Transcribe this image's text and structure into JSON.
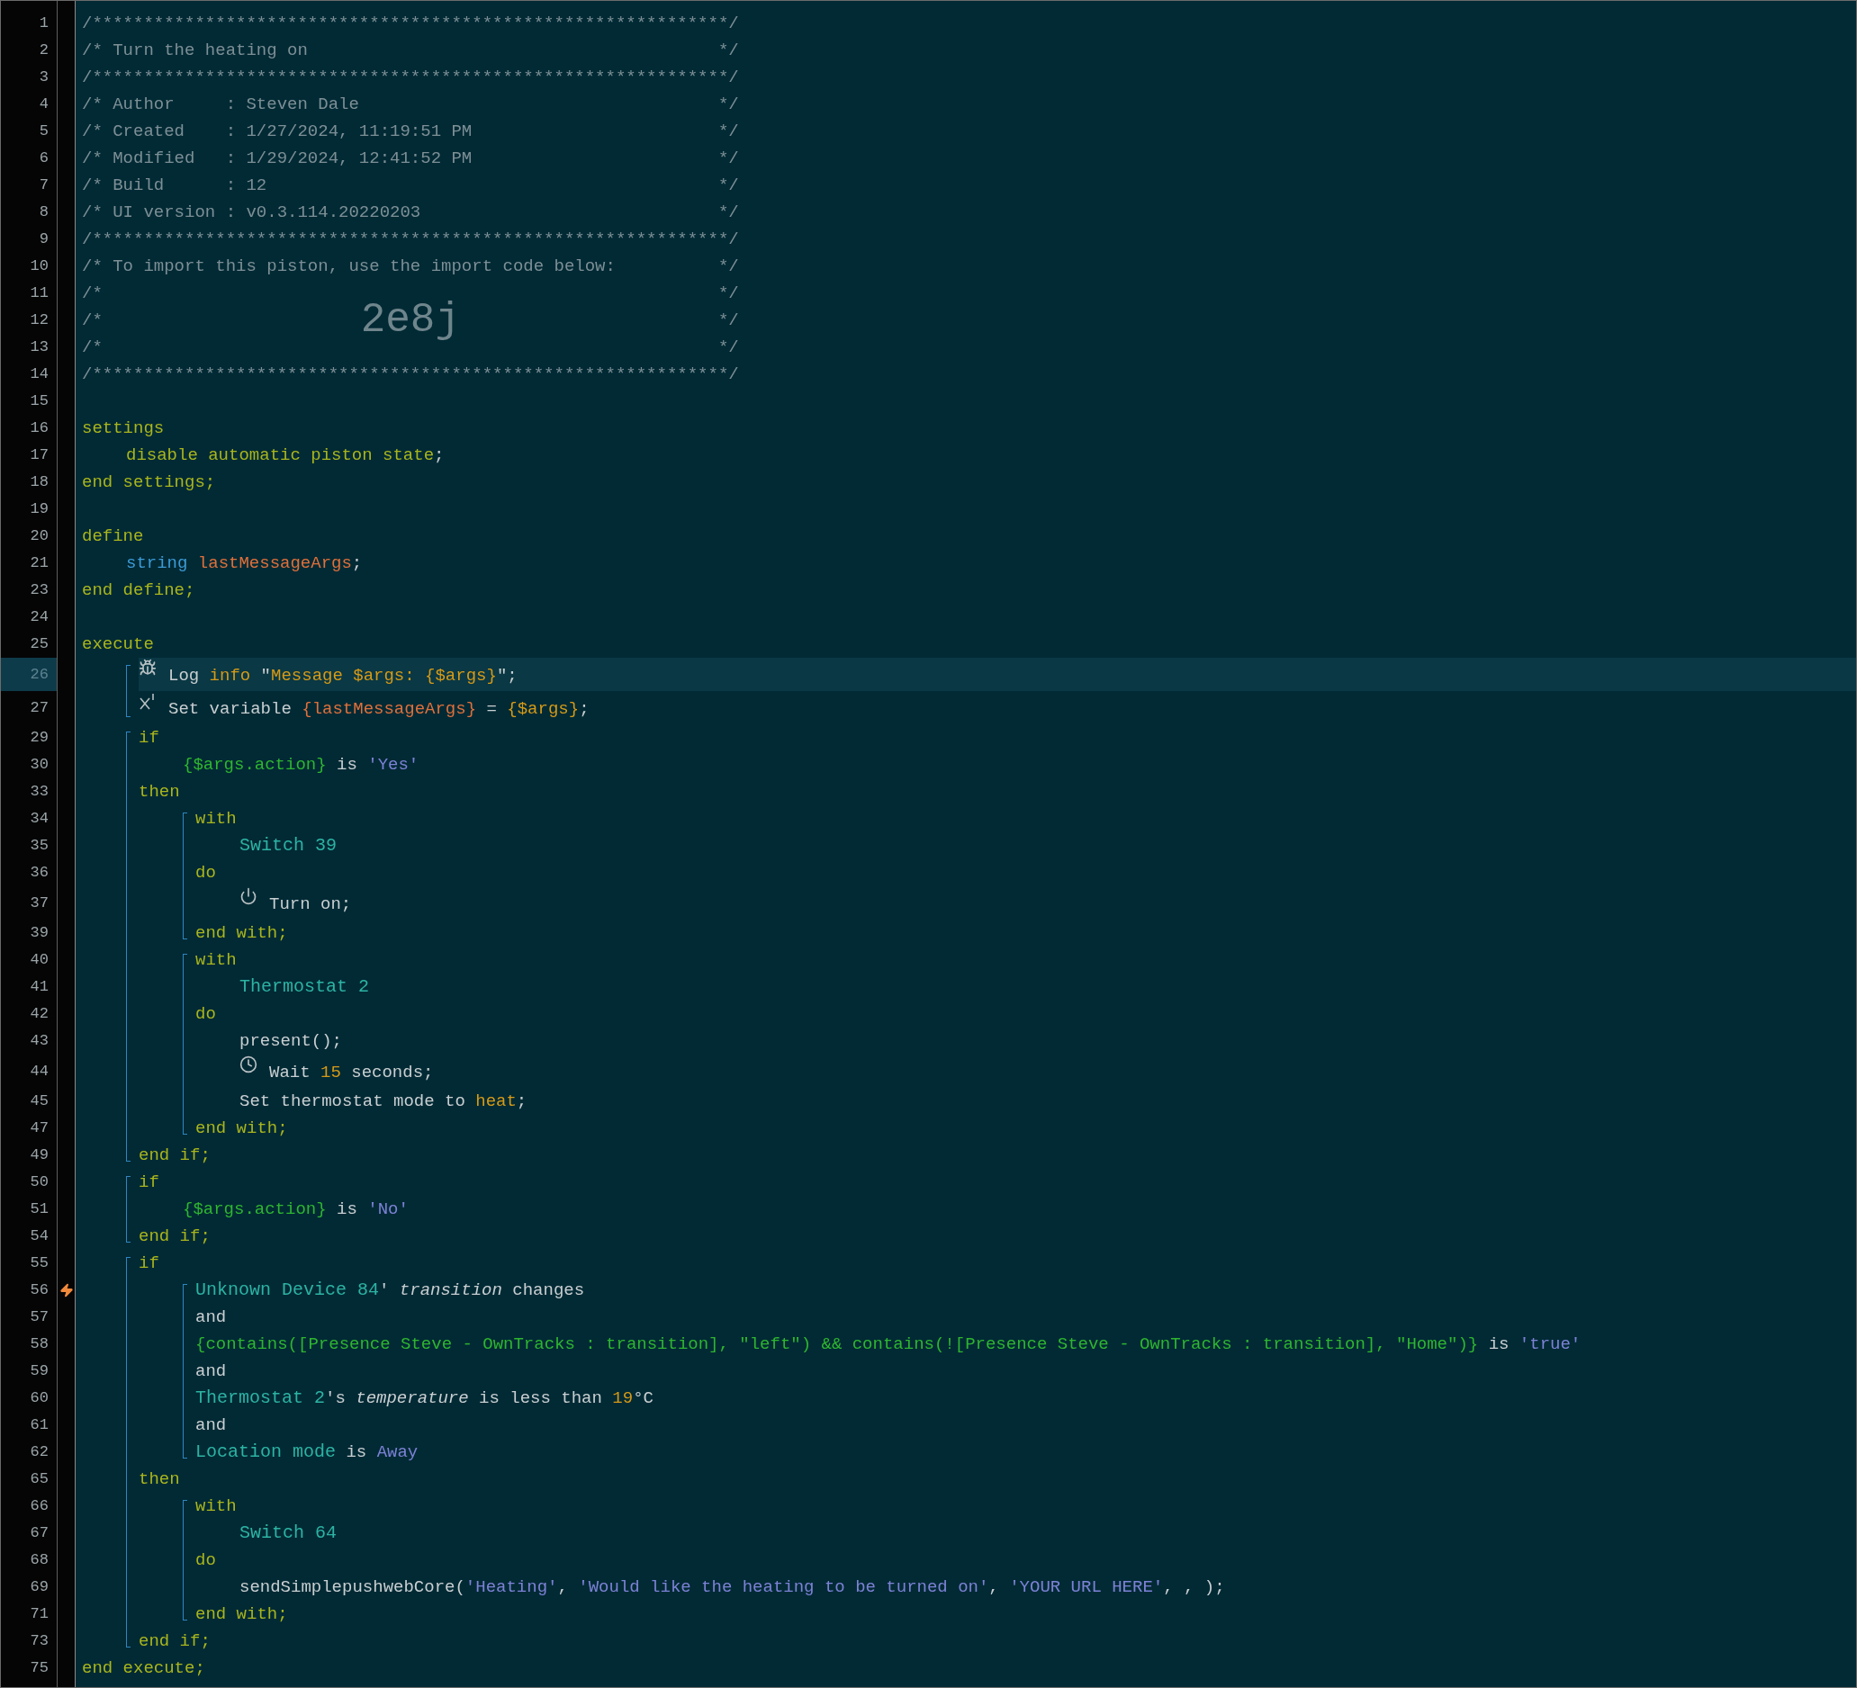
{
  "lines": [
    {
      "kind": "box",
      "number": "1",
      "selected": false,
      "trigger": false,
      "tokens": [
        {
          "kind": "comment",
          "text": "/**************************************************************/"
        }
      ]
    },
    {
      "kind": "box",
      "number": "2",
      "selected": false,
      "trigger": false,
      "tokens": [
        {
          "kind": "comment",
          "text": "/* Turn the heating on"
        },
        {
          "kind": "comment",
          "text": "*/"
        }
      ]
    },
    {
      "kind": "box",
      "number": "3",
      "selected": false,
      "trigger": false,
      "tokens": [
        {
          "kind": "comment",
          "text": "/**************************************************************/"
        }
      ]
    },
    {
      "kind": "box",
      "number": "4",
      "selected": false,
      "trigger": false,
      "tokens": [
        {
          "kind": "comment",
          "text": "/* Author     : Steven Dale"
        },
        {
          "kind": "comment",
          "text": "*/"
        }
      ]
    },
    {
      "kind": "box",
      "number": "5",
      "selected": false,
      "trigger": false,
      "tokens": [
        {
          "kind": "comment",
          "text": "/* Created    : 1/27/2024, 11:19:51 PM"
        },
        {
          "kind": "comment",
          "text": "*/"
        }
      ]
    },
    {
      "kind": "box",
      "number": "6",
      "selected": false,
      "trigger": false,
      "tokens": [
        {
          "kind": "comment",
          "text": "/* Modified   : 1/29/2024, 12:41:52 PM"
        },
        {
          "kind": "comment",
          "text": "*/"
        }
      ]
    },
    {
      "kind": "box",
      "number": "7",
      "selected": false,
      "trigger": false,
      "tokens": [
        {
          "kind": "comment",
          "text": "/* Build      : 12"
        },
        {
          "kind": "comment",
          "text": "*/"
        }
      ]
    },
    {
      "kind": "box",
      "number": "8",
      "selected": false,
      "trigger": false,
      "tokens": [
        {
          "kind": "comment",
          "text": "/* UI version : v0.3.114.20220203"
        },
        {
          "kind": "comment",
          "text": "*/"
        }
      ]
    },
    {
      "kind": "box",
      "number": "9",
      "selected": false,
      "trigger": false,
      "tokens": [
        {
          "kind": "comment",
          "text": "/**************************************************************/"
        }
      ]
    },
    {
      "kind": "box",
      "number": "10",
      "selected": false,
      "trigger": false,
      "tokens": [
        {
          "kind": "comment",
          "text": "/* To import this piston, use the import code below:"
        },
        {
          "kind": "comment",
          "text": "*/"
        }
      ]
    },
    {
      "kind": "box",
      "number": "11",
      "selected": false,
      "trigger": false,
      "tokens": [
        {
          "kind": "comment",
          "text": "/*"
        },
        {
          "kind": "comment",
          "text": "*/"
        }
      ]
    },
    {
      "kind": "box",
      "number": "12",
      "selected": false,
      "trigger": false,
      "tokens": [
        {
          "kind": "comment",
          "text": "/*"
        },
        {
          "kind": "import_code",
          "text": "2e8j"
        },
        {
          "kind": "comment",
          "text": "*/"
        }
      ]
    },
    {
      "kind": "box",
      "number": "13",
      "selected": false,
      "trigger": false,
      "tokens": [
        {
          "kind": "comment",
          "text": "/*"
        },
        {
          "kind": "comment",
          "text": "*/"
        }
      ]
    },
    {
      "kind": "box",
      "number": "14",
      "selected": false,
      "trigger": false,
      "tokens": [
        {
          "kind": "comment",
          "text": "/**************************************************************/"
        }
      ]
    },
    {
      "kind": "blank",
      "number": "15",
      "selected": false,
      "trigger": false
    },
    {
      "kind": "code",
      "number": "16",
      "selected": false,
      "trigger": false,
      "tokens": [
        {
          "kind": "keyword",
          "text": "settings"
        }
      ],
      "children": [
        {
          "kind": "code",
          "number": "17",
          "selected": false,
          "trigger": false,
          "tokens": [
            {
              "kind": "keyword",
              "text": "disable automatic piston state"
            },
            {
              "kind": "plain",
              "text": ";"
            }
          ]
        }
      ]
    },
    {
      "kind": "code",
      "number": "18",
      "selected": false,
      "trigger": false,
      "tokens": [
        {
          "kind": "keyword",
          "text": "end settings;"
        }
      ]
    },
    {
      "kind": "blank",
      "number": "19",
      "selected": false,
      "trigger": false
    },
    {
      "kind": "code",
      "number": "20",
      "selected": false,
      "trigger": false,
      "tokens": [
        {
          "kind": "keyword",
          "text": "define"
        }
      ],
      "children": [
        {
          "kind": "code",
          "number": "21",
          "selected": false,
          "trigger": false,
          "tokens": [
            {
              "kind": "type",
              "text": "string "
            },
            {
              "kind": "variable",
              "text": "lastMessageArgs"
            },
            {
              "kind": "plain",
              "text": ";"
            }
          ]
        }
      ]
    },
    {
      "kind": "code",
      "number": "23",
      "selected": false,
      "trigger": false,
      "tokens": [
        {
          "kind": "keyword",
          "text": "end define;"
        }
      ]
    },
    {
      "kind": "blank",
      "number": "24",
      "selected": false,
      "trigger": false
    },
    {
      "kind": "code",
      "number": "25",
      "selected": false,
      "trigger": false,
      "tokens": [
        {
          "kind": "keyword",
          "text": "execute"
        }
      ],
      "children": [
        {
          "kind": "block",
          "items": [
            {
              "kind": "log",
              "number": "26",
              "selected": true,
              "trigger": false,
              "tokens": [
                {
                  "kind": "plain",
                  "text": "Log "
                },
                {
                  "kind": "system",
                  "text": "info"
                },
                {
                  "kind": "plain",
                  "text": " \""
                },
                {
                  "kind": "system",
                  "text": "Message $args: {$args}"
                },
                {
                  "kind": "plain",
                  "text": "\";"
                }
              ]
            },
            {
              "kind": "assign",
              "number": "27",
              "selected": false,
              "trigger": false,
              "tokens": [
                {
                  "kind": "plain",
                  "text": "Set variable "
                },
                {
                  "kind": "variable",
                  "text": "{lastMessageArgs}"
                },
                {
                  "kind": "plain",
                  "text": " = "
                },
                {
                  "kind": "system",
                  "text": "{$args}"
                },
                {
                  "kind": "plain",
                  "text": ";"
                }
              ]
            }
          ]
        },
        {
          "kind": "block",
          "items": [
            {
              "kind": "code",
              "number": "29",
              "selected": false,
              "trigger": false,
              "tokens": [
                {
                  "kind": "keyword",
                  "text": "if"
                }
              ],
              "children": [
                {
                  "kind": "code",
                  "number": "30",
                  "selected": false,
                  "trigger": false,
                  "tokens": [
                    {
                      "kind": "expression",
                      "text": "{$args.action}"
                    },
                    {
                      "kind": "plain",
                      "text": " is "
                    },
                    {
                      "kind": "string",
                      "text": "'Yes'"
                    }
                  ]
                }
              ]
            },
            {
              "kind": "code",
              "number": "33",
              "selected": false,
              "trigger": false,
              "tokens": [
                {
                  "kind": "keyword",
                  "text": "then"
                }
              ],
              "children": [
                {
                  "kind": "block",
                  "items": [
                    {
                      "kind": "code",
                      "number": "34",
                      "selected": false,
                      "trigger": false,
                      "tokens": [
                        {
                          "kind": "keyword",
                          "text": "with"
                        }
                      ],
                      "children": [
                        {
                          "kind": "code",
                          "number": "35",
                          "selected": false,
                          "trigger": false,
                          "tokens": [
                            {
                              "kind": "device",
                              "text": "Switch 39"
                            }
                          ]
                        }
                      ]
                    },
                    {
                      "kind": "code",
                      "number": "36",
                      "selected": false,
                      "trigger": false,
                      "tokens": [
                        {
                          "kind": "keyword",
                          "text": "do"
                        }
                      ],
                      "children": [
                        {
                          "kind": "command",
                          "number": "37",
                          "selected": false,
                          "trigger": false,
                          "tokens": [
                            {
                              "kind": "plain",
                              "text": "Turn on;"
                            }
                          ]
                        }
                      ]
                    },
                    {
                      "kind": "code",
                      "number": "39",
                      "selected": false,
                      "trigger": false,
                      "tokens": [
                        {
                          "kind": "keyword",
                          "text": "end with;"
                        }
                      ]
                    }
                  ]
                },
                {
                  "kind": "block",
                  "items": [
                    {
                      "kind": "code",
                      "number": "40",
                      "selected": false,
                      "trigger": false,
                      "tokens": [
                        {
                          "kind": "keyword",
                          "text": "with"
                        }
                      ],
                      "children": [
                        {
                          "kind": "code",
                          "number": "41",
                          "selected": false,
                          "trigger": false,
                          "tokens": [
                            {
                              "kind": "device",
                              "text": "Thermostat 2"
                            }
                          ]
                        }
                      ]
                    },
                    {
                      "kind": "code",
                      "number": "42",
                      "selected": false,
                      "trigger": false,
                      "tokens": [
                        {
                          "kind": "keyword",
                          "text": "do"
                        }
                      ],
                      "children": [
                        {
                          "kind": "code",
                          "number": "43",
                          "selected": false,
                          "trigger": false,
                          "tokens": [
                            {
                              "kind": "plain",
                              "text": "present();"
                            }
                          ]
                        },
                        {
                          "kind": "wait",
                          "number": "44",
                          "selected": false,
                          "trigger": false,
                          "tokens": [
                            {
                              "kind": "plain",
                              "text": "Wait "
                            },
                            {
                              "kind": "number",
                              "text": "15"
                            },
                            {
                              "kind": "plain",
                              "text": " seconds;"
                            }
                          ]
                        },
                        {
                          "kind": "code",
                          "number": "45",
                          "selected": false,
                          "trigger": false,
                          "tokens": [
                            {
                              "kind": "plain",
                              "text": "Set thermostat mode to "
                            },
                            {
                              "kind": "system",
                              "text": "heat"
                            },
                            {
                              "kind": "plain",
                              "text": ";"
                            }
                          ]
                        }
                      ]
                    },
                    {
                      "kind": "code",
                      "number": "47",
                      "selected": false,
                      "trigger": false,
                      "tokens": [
                        {
                          "kind": "keyword",
                          "text": "end with;"
                        }
                      ]
                    }
                  ]
                }
              ]
            },
            {
              "kind": "code",
              "number": "49",
              "selected": false,
              "trigger": false,
              "tokens": [
                {
                  "kind": "keyword",
                  "text": "end if;"
                }
              ]
            }
          ]
        },
        {
          "kind": "block",
          "items": [
            {
              "kind": "code",
              "number": "50",
              "selected": false,
              "trigger": false,
              "tokens": [
                {
                  "kind": "keyword",
                  "text": "if"
                }
              ],
              "children": [
                {
                  "kind": "code",
                  "number": "51",
                  "selected": false,
                  "trigger": false,
                  "tokens": [
                    {
                      "kind": "expression",
                      "text": "{$args.action}"
                    },
                    {
                      "kind": "plain",
                      "text": " is "
                    },
                    {
                      "kind": "string",
                      "text": "'No'"
                    }
                  ]
                }
              ]
            },
            {
              "kind": "code",
              "number": "54",
              "selected": false,
              "trigger": false,
              "tokens": [
                {
                  "kind": "keyword",
                  "text": "end if;"
                }
              ]
            }
          ]
        },
        {
          "kind": "block",
          "items": [
            {
              "kind": "code",
              "number": "55",
              "selected": false,
              "trigger": false,
              "tokens": [
                {
                  "kind": "keyword",
                  "text": "if"
                }
              ],
              "children": [
                {
                  "kind": "block",
                  "items": [
                    {
                      "kind": "code",
                      "number": "56",
                      "selected": false,
                      "trigger": true,
                      "tokens": [
                        {
                          "kind": "device",
                          "text": "Unknown Device 84"
                        },
                        {
                          "kind": "plain",
                          "text": "' "
                        },
                        {
                          "kind": "attribute",
                          "text": "transition"
                        },
                        {
                          "kind": "plain",
                          "text": " changes"
                        }
                      ]
                    },
                    {
                      "kind": "code",
                      "number": "57",
                      "selected": false,
                      "trigger": false,
                      "tokens": [
                        {
                          "kind": "plain",
                          "text": "and"
                        }
                      ]
                    },
                    {
                      "kind": "code",
                      "number": "58",
                      "selected": false,
                      "trigger": false,
                      "tokens": [
                        {
                          "kind": "expression",
                          "text": "{contains([Presence Steve - OwnTracks : transition], \"left\") && contains(![Presence Steve - OwnTracks : transition], \"Home\")}"
                        },
                        {
                          "kind": "plain",
                          "text": " is "
                        },
                        {
                          "kind": "string",
                          "text": "'true'"
                        }
                      ]
                    },
                    {
                      "kind": "code",
                      "number": "59",
                      "selected": false,
                      "trigger": false,
                      "tokens": [
                        {
                          "kind": "plain",
                          "text": "and"
                        }
                      ]
                    },
                    {
                      "kind": "code",
                      "number": "60",
                      "selected": false,
                      "trigger": false,
                      "tokens": [
                        {
                          "kind": "device",
                          "text": "Thermostat 2"
                        },
                        {
                          "kind": "plain",
                          "text": "'s "
                        },
                        {
                          "kind": "attribute",
                          "text": "temperature"
                        },
                        {
                          "kind": "plain",
                          "text": " is less than "
                        },
                        {
                          "kind": "number",
                          "text": "19"
                        },
                        {
                          "kind": "plain",
                          "text": "°C"
                        }
                      ]
                    },
                    {
                      "kind": "code",
                      "number": "61",
                      "selected": false,
                      "trigger": false,
                      "tokens": [
                        {
                          "kind": "plain",
                          "text": "and"
                        }
                      ]
                    },
                    {
                      "kind": "code",
                      "number": "62",
                      "selected": false,
                      "trigger": false,
                      "tokens": [
                        {
                          "kind": "device",
                          "text": "Location mode"
                        },
                        {
                          "kind": "plain",
                          "text": " is "
                        },
                        {
                          "kind": "string",
                          "text": "Away"
                        }
                      ]
                    }
                  ]
                }
              ]
            },
            {
              "kind": "code",
              "number": "65",
              "selected": false,
              "trigger": false,
              "tokens": [
                {
                  "kind": "keyword",
                  "text": "then"
                }
              ],
              "children": [
                {
                  "kind": "block",
                  "items": [
                    {
                      "kind": "code",
                      "number": "66",
                      "selected": false,
                      "trigger": false,
                      "tokens": [
                        {
                          "kind": "keyword",
                          "text": "with"
                        }
                      ],
                      "children": [
                        {
                          "kind": "code",
                          "number": "67",
                          "selected": false,
                          "trigger": false,
                          "tokens": [
                            {
                              "kind": "device",
                              "text": "Switch 64"
                            }
                          ]
                        }
                      ]
                    },
                    {
                      "kind": "code",
                      "number": "68",
                      "selected": false,
                      "trigger": false,
                      "tokens": [
                        {
                          "kind": "keyword",
                          "text": "do"
                        }
                      ],
                      "children": [
                        {
                          "kind": "code",
                          "number": "69",
                          "selected": false,
                          "trigger": false,
                          "tokens": [
                            {
                              "kind": "plain",
                              "text": "sendSimplepushwebCore("
                            },
                            {
                              "kind": "string",
                              "text": "'Heating'"
                            },
                            {
                              "kind": "plain",
                              "text": ", "
                            },
                            {
                              "kind": "string",
                              "text": "'Would like the heating to be turned on'"
                            },
                            {
                              "kind": "plain",
                              "text": ", "
                            },
                            {
                              "kind": "string",
                              "text": "'YOUR URL HERE'"
                            },
                            {
                              "kind": "plain",
                              "text": ", , );"
                            }
                          ]
                        }
                      ]
                    },
                    {
                      "kind": "code",
                      "number": "71",
                      "selected": false,
                      "trigger": false,
                      "tokens": [
                        {
                          "kind": "keyword",
                          "text": "end with;"
                        }
                      ]
                    }
                  ]
                }
              ]
            },
            {
              "kind": "code",
              "number": "73",
              "selected": false,
              "trigger": false,
              "tokens": [
                {
                  "kind": "keyword",
                  "text": "end if;"
                }
              ]
            }
          ]
        }
      ]
    },
    {
      "kind": "code",
      "number": "75",
      "selected": false,
      "trigger": false,
      "tokens": [
        {
          "kind": "keyword",
          "text": "end execute;"
        }
      ]
    }
  ]
}
